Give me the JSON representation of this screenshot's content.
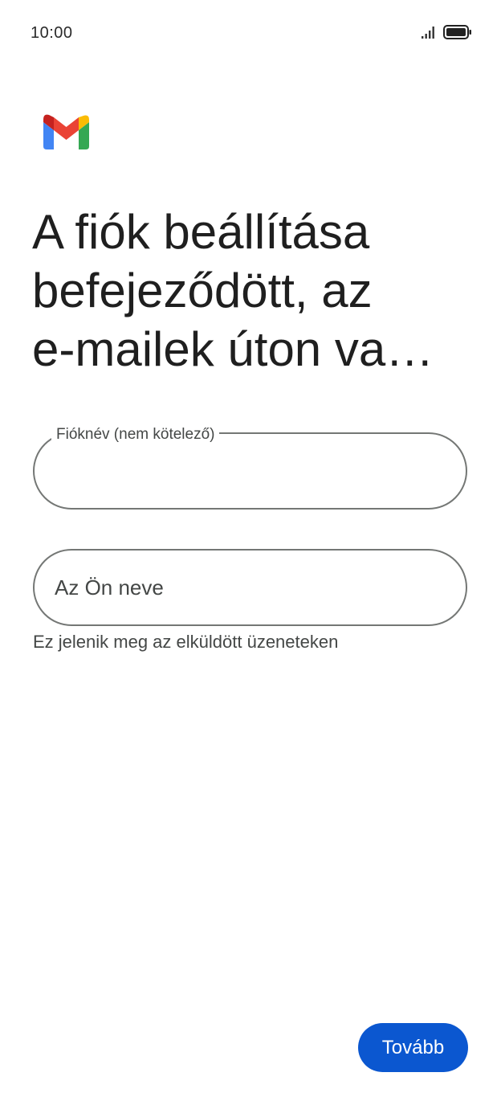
{
  "status_bar": {
    "time": "10:00",
    "icons": [
      "signal-icon",
      "battery-icon"
    ]
  },
  "brand": {
    "logo": "gmail-logo",
    "colors": {
      "red": "#EA4335",
      "dark_red": "#C5221F",
      "blue": "#4285F4",
      "green": "#34A853",
      "yellow": "#FBBC04"
    }
  },
  "headline": "A fiók beállítása\nbefejeződött, az\ne-mailek úton va…",
  "form": {
    "account_name": {
      "label": "Fióknév (nem kötelező)",
      "value": ""
    },
    "your_name": {
      "placeholder": "Az Ön neve",
      "value": "",
      "helper": "Ez jelenik meg az elküldött üzeneteken"
    }
  },
  "actions": {
    "next_label": "Tovább"
  },
  "theme": {
    "accent": "#0B57D0",
    "outline": "#747775",
    "text": "#1F1F1F",
    "secondary_text": "#444746"
  }
}
